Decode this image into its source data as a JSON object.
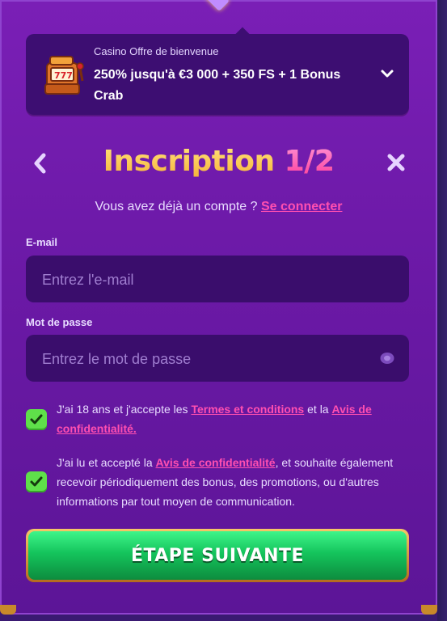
{
  "offer": {
    "label": "Casino Offre de bienvenue",
    "title": "250% jusqu'à €3 000 + 350 FS + 1 Bonus Crab"
  },
  "header": {
    "title_main": "Inscription ",
    "title_step": "1/2"
  },
  "login": {
    "prompt": "Vous avez déjà un compte ?",
    "link": "Se connecter"
  },
  "email": {
    "label": "E-mail",
    "placeholder": "Entrez l'e-mail",
    "value": ""
  },
  "password": {
    "label": "Mot de passe",
    "placeholder": "Entrez le mot de passe",
    "value": ""
  },
  "consent_terms": {
    "text_before": "J'ai 18 ans et j'accepte les ",
    "terms_link": "Termes et conditions",
    "text_middle": " et la ",
    "privacy_link": "Avis de confidentialité.",
    "checked": true
  },
  "consent_marketing": {
    "text_before": "J'ai lu et accepté la ",
    "privacy_link": "Avis de confidentialité",
    "text_after": ", et souhaite également recevoir périodiquement des bonus, des promotions, ou d'autres informations par tout moyen de communication.",
    "checked": true
  },
  "next_button": {
    "label": "ÉTAPE SUIVANTE"
  },
  "colors": {
    "accent_pink": "#ff4fb0",
    "title_gold": "#f6b43a",
    "button_green": "#14c45c",
    "checkbox_green": "#5fe04a"
  },
  "icons": {
    "offer": "slot-machine-icon",
    "expand": "chevron-down-icon",
    "back": "chevron-left-icon",
    "close": "close-icon",
    "password_toggle": "eye-icon",
    "check": "check-icon"
  }
}
